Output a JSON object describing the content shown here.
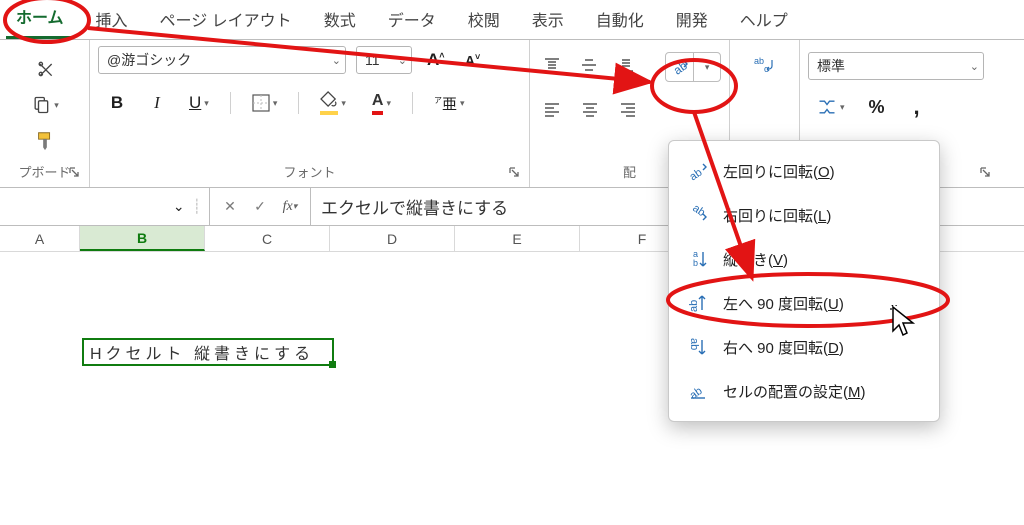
{
  "tabs": {
    "items": [
      "ホーム",
      "挿入",
      "ページ レイアウト",
      "数式",
      "データ",
      "校閲",
      "表示",
      "自動化",
      "開発",
      "ヘルプ"
    ],
    "active_index": 0
  },
  "clipboard": {
    "label": "プボード"
  },
  "font": {
    "family": "@游ゴシック",
    "size": "11",
    "label": "フォント"
  },
  "alignment": {
    "label": "配"
  },
  "number_format": {
    "selected": "標準"
  },
  "orientation_menu": {
    "items": [
      {
        "label_pre": "左回りに回転(",
        "hotkey": "O",
        "label_post": ")"
      },
      {
        "label_pre": "右回りに回転(",
        "hotkey": "L",
        "label_post": ")"
      },
      {
        "label_pre": "縦書き(",
        "hotkey": "V",
        "label_post": ")"
      },
      {
        "label_pre": "左へ 90 度回転(",
        "hotkey": "U",
        "label_post": ")"
      },
      {
        "label_pre": "右へ 90 度回転(",
        "hotkey": "D",
        "label_post": ")"
      },
      {
        "label_pre": "セルの配置の設定(",
        "hotkey": "M",
        "label_post": ")"
      }
    ]
  },
  "formula_bar": {
    "value": "エクセルで縦書きにする"
  },
  "columns": [
    "A",
    "B",
    "C",
    "D",
    "E",
    "F"
  ],
  "active_column_index": 1,
  "cell": {
    "display": "Hクセルト 縦書きにする"
  },
  "colors": {
    "accent": "#107c10",
    "annotation": "#e21414",
    "fill_swatch": "#ffd24a",
    "font_swatch": "#e21414"
  }
}
